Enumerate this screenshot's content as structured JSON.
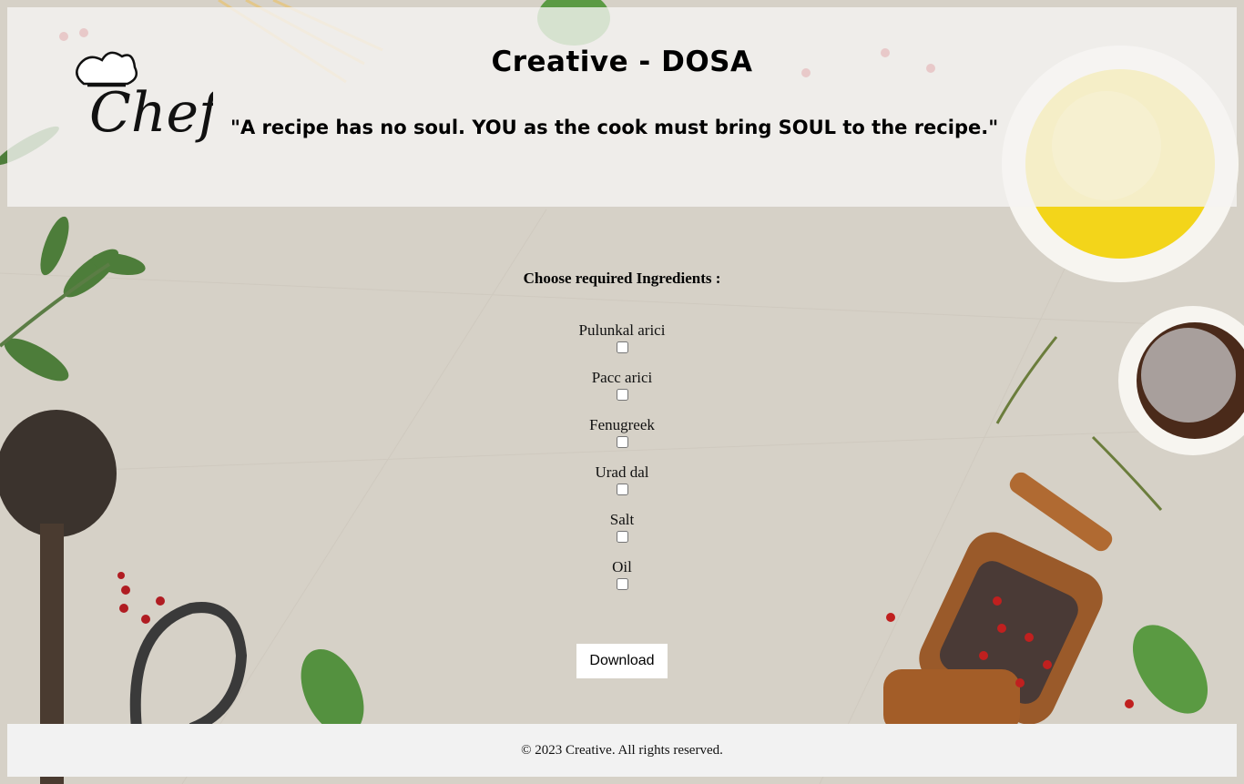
{
  "header": {
    "logo_text": "Chef",
    "title": "Creative - DOSA",
    "quote": "\"A recipe has no soul. YOU as the cook must bring SOUL to the recipe.\""
  },
  "form": {
    "heading": "Choose required Ingredients :",
    "ingredients": [
      {
        "label": "Pulunkal arici",
        "checked": false
      },
      {
        "label": "Pacc arici",
        "checked": false
      },
      {
        "label": "Fenugreek",
        "checked": false
      },
      {
        "label": "Urad dal",
        "checked": false
      },
      {
        "label": "Salt",
        "checked": false
      },
      {
        "label": "Oil",
        "checked": false
      }
    ],
    "download_label": "Download"
  },
  "footer": {
    "text": "© 2023 Creative. All rights reserved."
  },
  "colors": {
    "header_bg": "#f5f4f2",
    "footer_bg": "#f2f2f2",
    "button_bg": "#ffffff",
    "page_bg": "#d7d2c8"
  }
}
